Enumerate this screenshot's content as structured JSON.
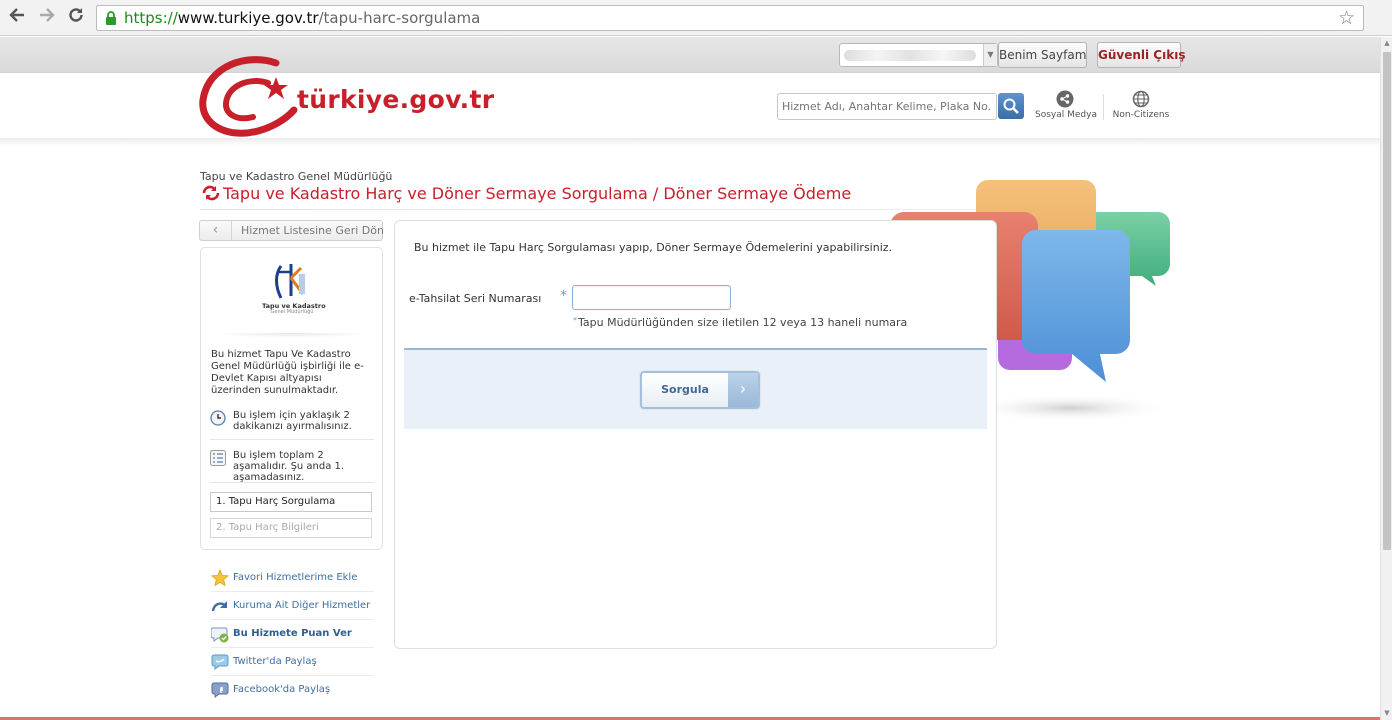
{
  "browser": {
    "url_scheme": "https://",
    "url_host": "www.turkiye.gov.tr",
    "url_path": "/tapu-harc-sorgulama",
    "icons": [
      "back-arrow-icon",
      "forward-arrow-icon",
      "reload-icon",
      "lock-icon",
      "bookmark-star-icon"
    ]
  },
  "topbar": {
    "my_page_label": "Benim Sayfam",
    "logout_label": "Güvenli Çıkış"
  },
  "header": {
    "logo_text": "türkiye.gov.tr",
    "search_placeholder": "Hizmet Adı, Anahtar Kelime, Plaka No...",
    "social_label": "Sosyal Medya",
    "noncitizens_label": "Non-Citizens"
  },
  "page": {
    "institution": "Tapu ve Kadastro Genel Müdürlüğü",
    "title": "Tapu ve Kadastro Harç ve Döner Sermaye Sorgulama / Döner Sermaye Ödeme"
  },
  "sidebar": {
    "back_label": "Hizmet Listesine Geri Dön",
    "logo_line1": "Tapu ve Kadastro",
    "logo_line2": "Genel Müdürlüğü",
    "description": "Bu hizmet Tapu Ve Kadastro Genel Müdürlüğü işbirliği ile e-Devlet Kapısı altyapısı üzerinden sunulmaktadır.",
    "time_info": "Bu işlem için yaklaşık 2 dakikanızı ayırmalısınız.",
    "steps_info": "Bu işlem toplam 2 aşamalıdır. Şu anda 1. aşamadasınız.",
    "steps": [
      "1. Tapu Harç Sorgulama",
      "2. Tapu Harç Bilgileri"
    ],
    "links": [
      {
        "label": "Favori Hizmetlerime Ekle",
        "icon": "star-icon"
      },
      {
        "label": "Kuruma Ait Diğer Hizmetler",
        "icon": "redo-arrow-icon"
      },
      {
        "label": "Bu Hizmete Puan Ver",
        "icon": "rating-icon"
      },
      {
        "label": "Twitter'da Paylaş",
        "icon": "twitter-bubble-icon"
      },
      {
        "label": "Facebook'da Paylaş",
        "icon": "facebook-bubble-icon"
      }
    ]
  },
  "form": {
    "intro": "Bu hizmet ile Tapu Harç Sorgulaması yapıp, Döner Sermaye Ödemelerini yapabilirsiniz.",
    "field_label": "e-Tahsilat Seri Numarası",
    "required_mark": "*",
    "field_value": "",
    "hint": "Tapu Müdürlüğünden size iletilen 12 veya 13 haneli numara",
    "submit_label": "Sorgula"
  },
  "colors": {
    "brand_red": "#c8202a",
    "link_blue": "#3e6ea4",
    "form_footer_bg": "#e9f0f7"
  }
}
